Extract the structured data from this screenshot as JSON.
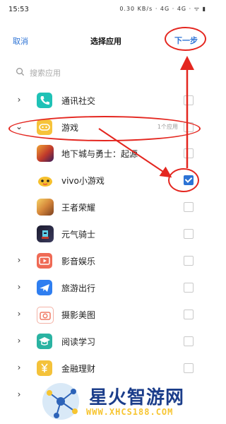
{
  "statusbar": {
    "time": "15:53",
    "indicators": "0.30 KB/s  ·  4G  ·  4G  ·  ᯤ  ▮"
  },
  "header": {
    "cancel_label": "取消",
    "title": "选择应用",
    "next_label": "下一步"
  },
  "search": {
    "placeholder": "搜索应用"
  },
  "categories": [
    {
      "label": "通讯社交",
      "icon": "phone-icon",
      "color": "#1fc2b6"
    },
    {
      "label": "游戏",
      "icon": "gamepad-icon",
      "color": "#f6c33a",
      "meta": "1个应用"
    },
    {
      "label": "影音娱乐",
      "icon": "play-icon",
      "color": "#ef6a55"
    },
    {
      "label": "旅游出行",
      "icon": "plane-icon",
      "color": "#2f7ef0"
    },
    {
      "label": "摄影美图",
      "icon": "camera-icon",
      "color": "#f07a63"
    },
    {
      "label": "阅读学习",
      "icon": "graduation-cap-icon",
      "color": "#2ab3a2"
    },
    {
      "label": "金融理财",
      "icon": "yuan-icon",
      "color": "#f4c23a"
    }
  ],
  "games": [
    {
      "label": "地下城与勇士：起源",
      "checked": false,
      "icon": "dnf-app-icon"
    },
    {
      "label": "vivo小游戏",
      "checked": true,
      "icon": "vivo-minigame-app-icon"
    },
    {
      "label": "王者荣耀",
      "checked": false,
      "icon": "honor-of-kings-app-icon"
    },
    {
      "label": "元气骑士",
      "checked": false,
      "icon": "soul-knight-app-icon"
    }
  ],
  "watermark": {
    "text": "星火智游网",
    "url": "WWW.XHCS188.COM"
  },
  "colors": {
    "accent": "#2d73d5",
    "annotation": "#e4261f"
  }
}
